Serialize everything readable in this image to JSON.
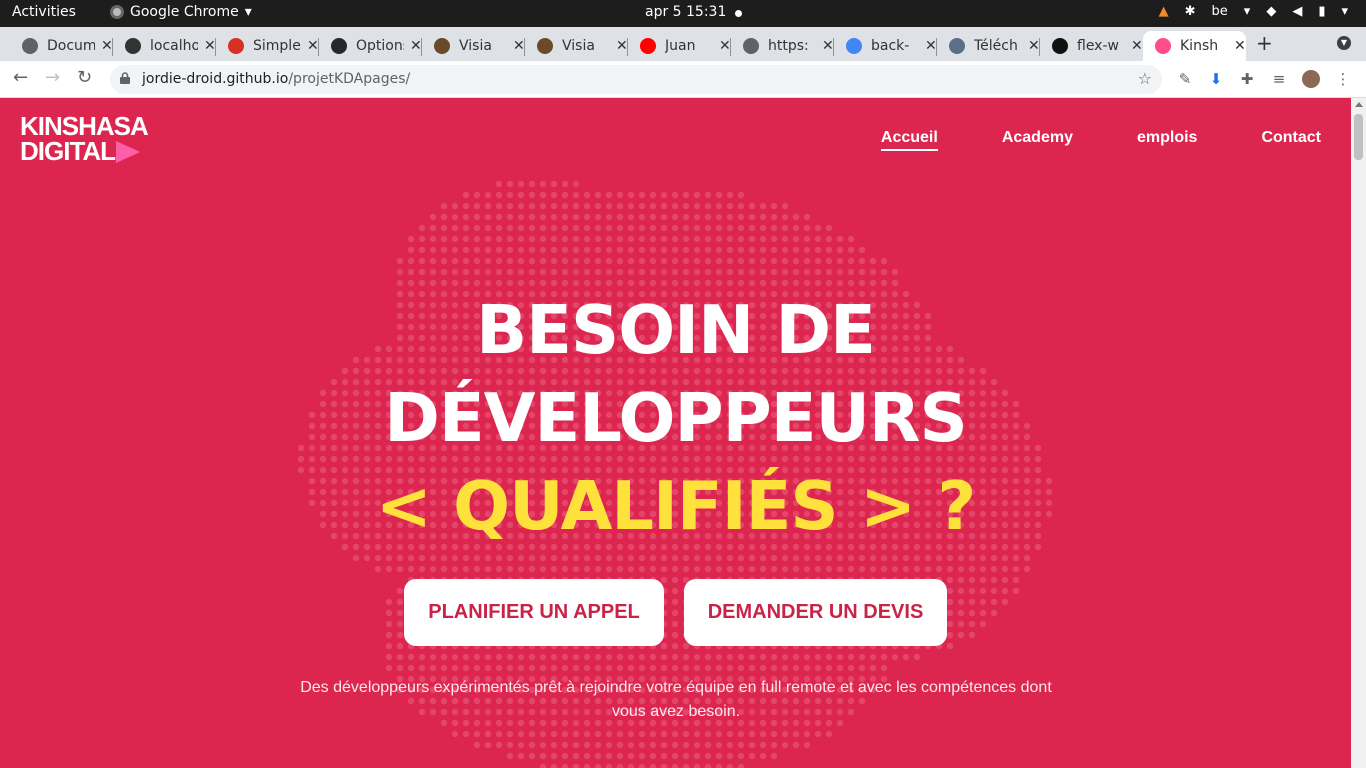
{
  "system": {
    "activities": "Activities",
    "app_name": "Google Chrome",
    "clock": "apr 5  15:31",
    "keyboard_layout": "be"
  },
  "tabs": [
    {
      "title": "Documen",
      "icon": "globe-icon"
    },
    {
      "title": "localhost",
      "icon": "terminal-icon"
    },
    {
      "title": "Simple",
      "icon": "circle-icon"
    },
    {
      "title": "Options",
      "icon": "github-icon"
    },
    {
      "title": "Visia",
      "icon": "image-icon"
    },
    {
      "title": "Visia",
      "icon": "image-icon"
    },
    {
      "title": "Juan",
      "icon": "youtube-icon"
    },
    {
      "title": "https:",
      "icon": "globe-icon"
    },
    {
      "title": "back-",
      "icon": "google-icon"
    },
    {
      "title": "Téléch",
      "icon": "layers-icon"
    },
    {
      "title": "flex-w",
      "icon": "codepen-icon"
    },
    {
      "title": "Kinsh",
      "icon": "play-icon"
    }
  ],
  "omnibox": {
    "host": "jordie-droid.github.io",
    "path": "/projetKDApages/"
  },
  "site": {
    "logo_line1": "KINSHASA",
    "logo_line2": "DIGITAL",
    "nav": [
      {
        "label": "Accueil",
        "current": true
      },
      {
        "label": "Academy"
      },
      {
        "label": "emplois"
      },
      {
        "label": "Contact"
      }
    ],
    "hero_line1": "BESOIN DE",
    "hero_line2": "DÉVELOPPEURS",
    "hero_line3": "< QUALIFIÉS > ?",
    "cta_primary": "PLANIFIER UN APPEL",
    "cta_secondary": "DEMANDER UN DEVIS",
    "description": "Des développeurs expérimentés prêt à rejoindre votre équipe en full remote et avec les compétences dont vous avez besoin."
  },
  "colors": {
    "brand_red": "#dc264f",
    "accent_yellow": "#ffe13b",
    "logo_pink": "#ff5fa8"
  }
}
